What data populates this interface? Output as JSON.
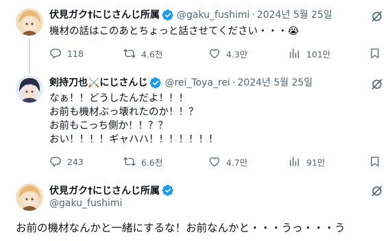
{
  "tweets": [
    {
      "name": "伏見ガク†にじさんじ所属",
      "handle": "@gaku_fushimi",
      "separator": "·",
      "date": "2024년 5월 25일",
      "text": "機材の話はこのあとちょっと話させてください・・・😭",
      "replies": "118",
      "retweets": "4.6천",
      "likes": "4.3만",
      "views": "101만"
    },
    {
      "name": "剣持刀也⚔️にじさんじ",
      "handle": "@rei_Toya_rei",
      "separator": "·",
      "date": "2024년 5월 25일",
      "text_lines": [
        "なぁ！！どうしたんだよ！！！",
        "お前も機材ぶっ壊れたのか！！？",
        "お前もこっち側か！！？？",
        "おい！！！！ギャハハ！！！！！！！"
      ],
      "replies": "243",
      "retweets": "6.6천",
      "likes": "4.7만",
      "views": "91만"
    }
  ],
  "main_tweet": {
    "name": "伏見ガク†にじさんじ所属",
    "handle": "@gaku_fushimi",
    "text": "お前の機材なんかと一緒にするな！お前なんかと・・・うっ・・・う"
  },
  "colors": {
    "verified": "#1d9bf0",
    "muted": "#536471",
    "text": "#0f1419",
    "thread_line": "#cfd9de"
  },
  "icons": [
    "verified-badge-icon",
    "grok-icon",
    "reply-icon",
    "retweet-icon",
    "like-icon",
    "views-icon",
    "bookmark-icon"
  ]
}
